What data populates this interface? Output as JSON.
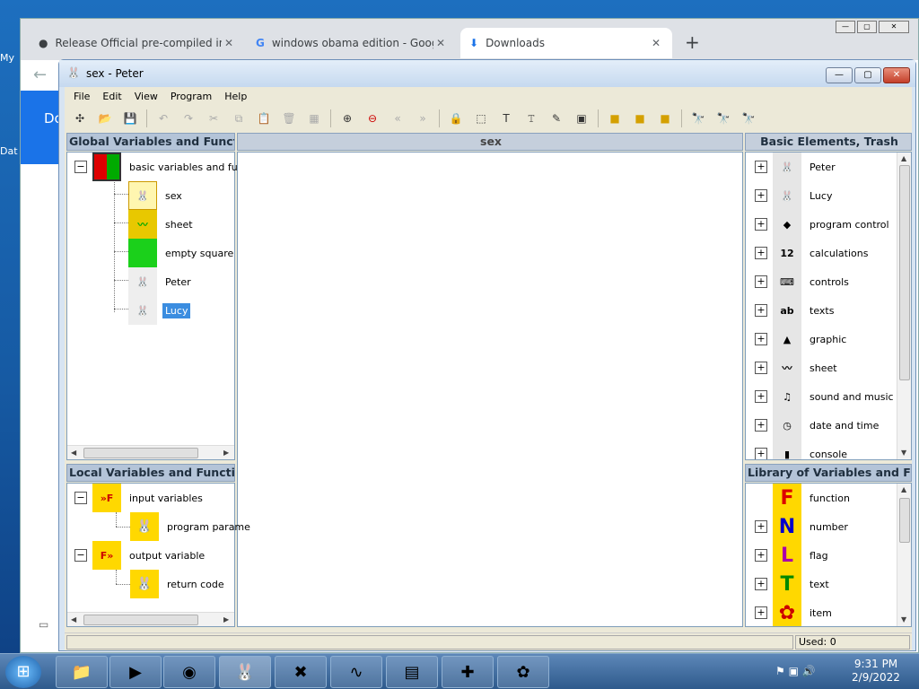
{
  "desktop": {
    "icon_labels": [
      "My",
      "Dat"
    ]
  },
  "browser": {
    "tabs": [
      {
        "title": "Release Official pre-compiled ins",
        "icon": "github-icon"
      },
      {
        "title": "windows obama edition - Google",
        "icon": "google-icon"
      },
      {
        "title": "Downloads",
        "icon": "download-icon"
      }
    ],
    "new_tab": "+",
    "side_text": "Do"
  },
  "app": {
    "title": "sex - Peter",
    "menu": [
      "File",
      "Edit",
      "View",
      "Program",
      "Help"
    ],
    "panels": {
      "global_header": "Global Variables and Functio",
      "center_header": "sex",
      "basic_header": "Basic Elements, Trash",
      "local_header": "Local Variables and Function",
      "library_header": "Library of Variables and Func"
    },
    "global_tree": {
      "root": "basic variables and fun",
      "children": [
        "sex",
        "sheet",
        "empty square",
        "Peter",
        "Lucy"
      ]
    },
    "local_tree": {
      "input": "input variables",
      "input_child": "program parame",
      "output": "output variable",
      "output_child": "return code"
    },
    "basic_elements": [
      "Peter",
      "Lucy",
      "program control",
      "calculations",
      "controls",
      "texts",
      "graphic",
      "sheet",
      "sound and music",
      "date and time",
      "console"
    ],
    "library": [
      "function",
      "number",
      "flag",
      "text",
      "item"
    ],
    "status": "Used: 0"
  },
  "taskbar": {
    "time": "9:31 PM",
    "date": "2/9/2022"
  },
  "colors": {
    "accent": "#3b8de0",
    "panel_header": "#b4c4d8",
    "desktop": "#1d6fbf"
  }
}
